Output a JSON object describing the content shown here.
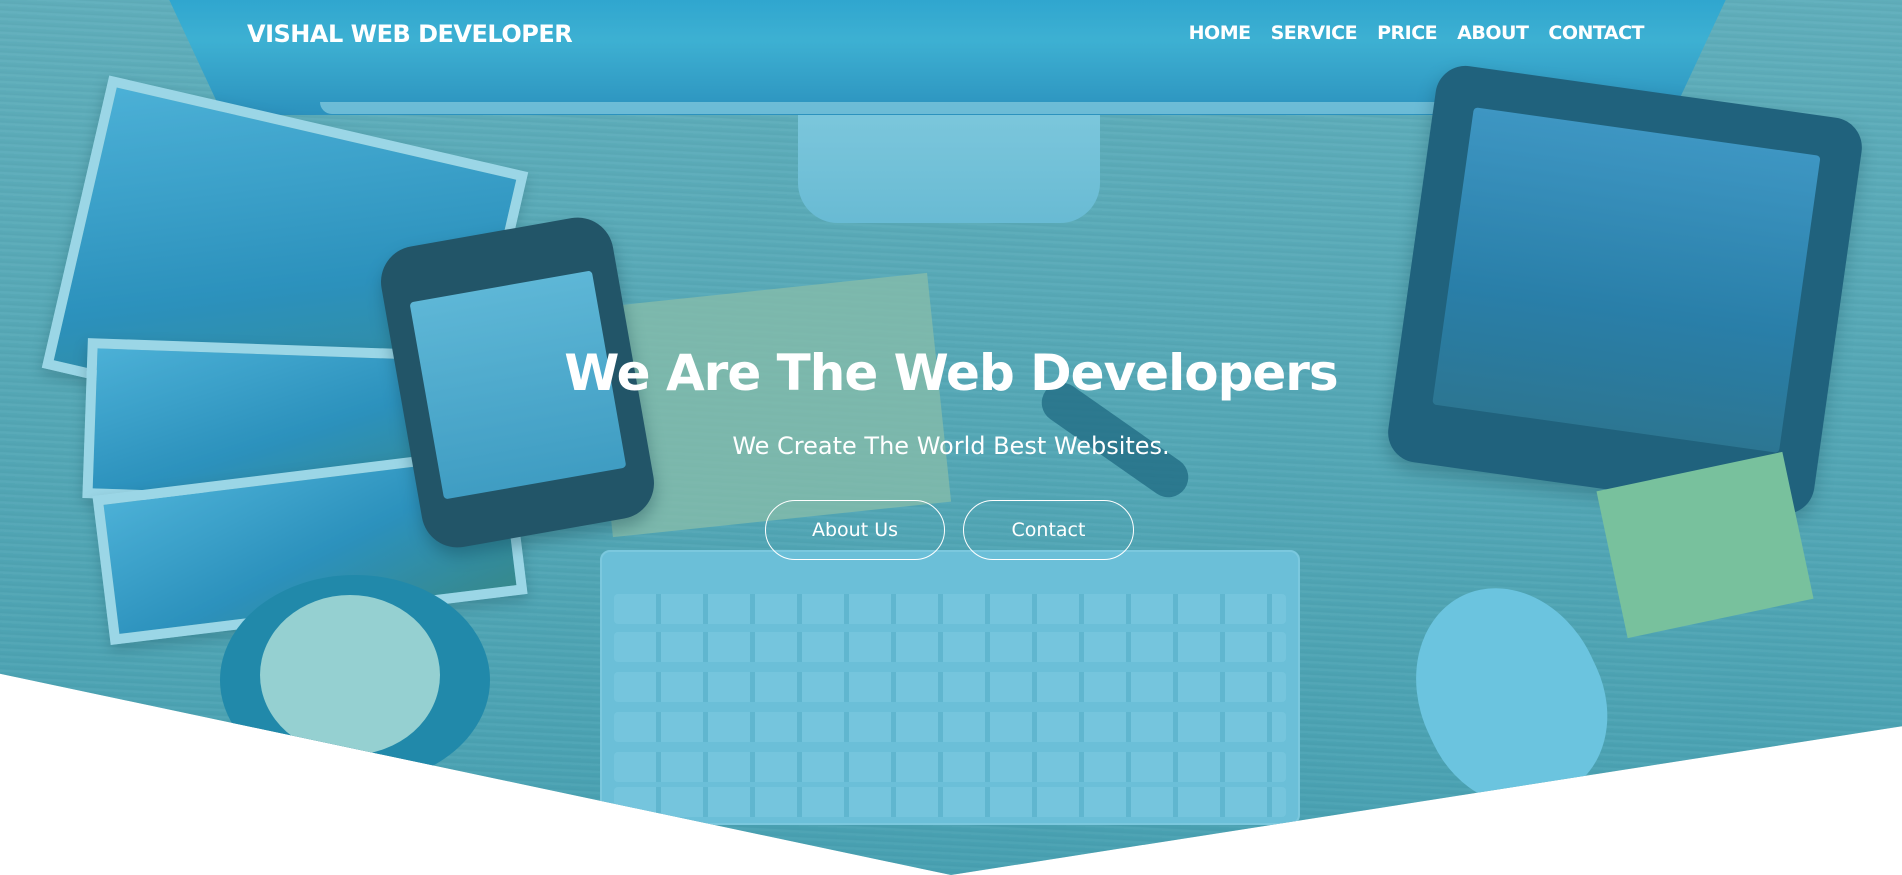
{
  "brand": {
    "name": "VISHAL WEB DEVELOPER"
  },
  "nav": {
    "items": [
      {
        "label": "HOME"
      },
      {
        "label": "SERVICE"
      },
      {
        "label": "PRICE"
      },
      {
        "label": "ABOUT"
      },
      {
        "label": "CONTACT"
      }
    ]
  },
  "hero": {
    "title": "We Are The Web Developers",
    "subtitle": "We Create The World Best Websites.",
    "buttons": {
      "about_label": "About Us",
      "contact_label": "Contact"
    },
    "background_image": "desk-workspace-image"
  },
  "colors": {
    "overlay": "#28a5c8",
    "text": "#ffffff",
    "page_background": "#ffffff"
  }
}
